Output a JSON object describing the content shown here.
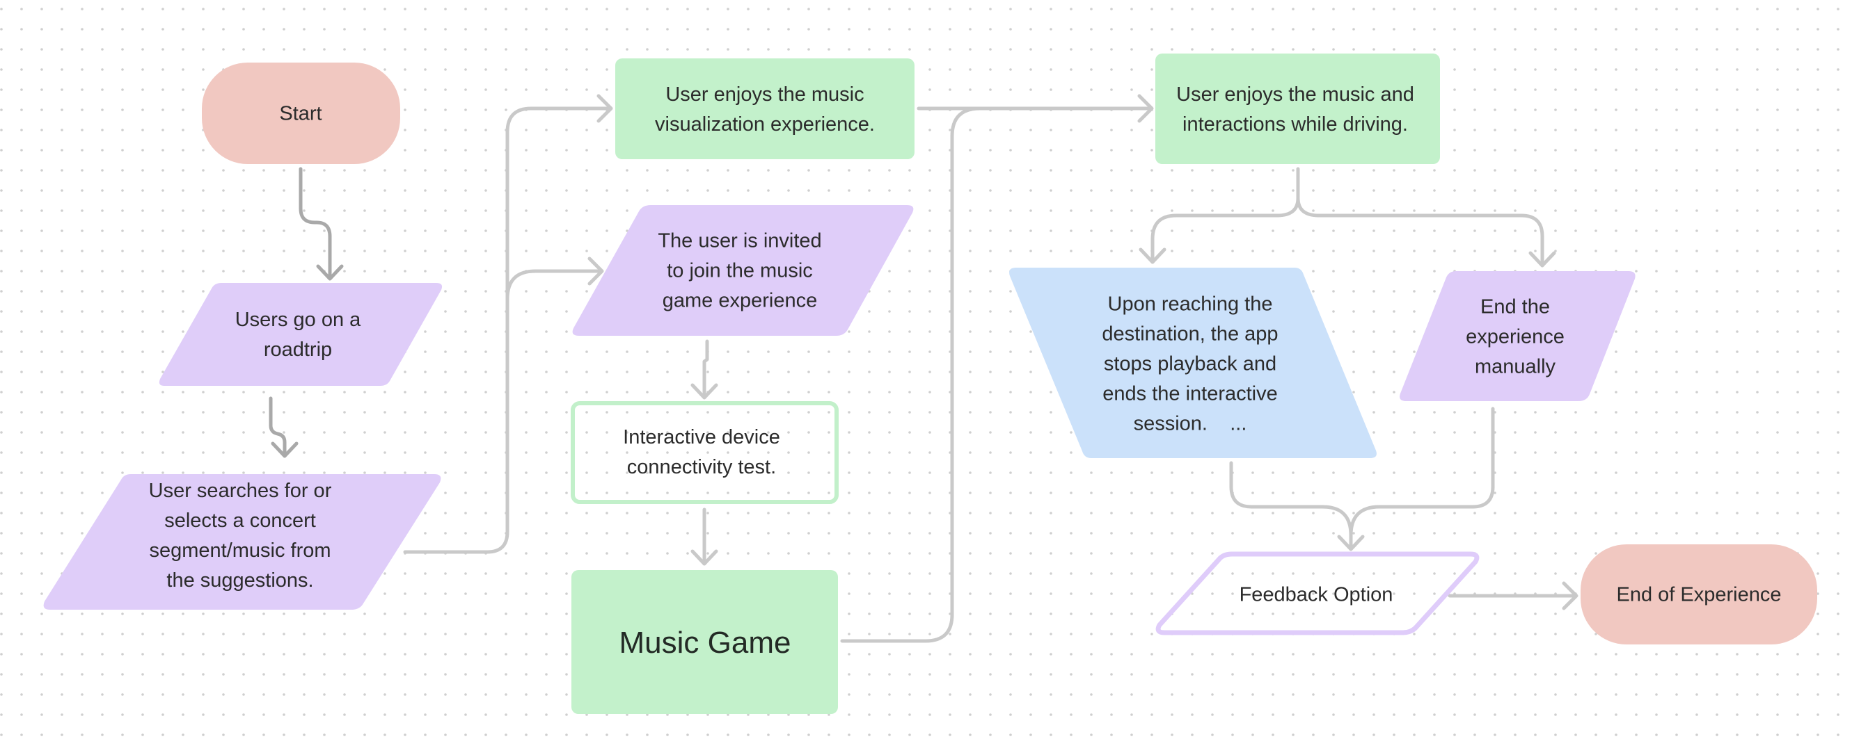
{
  "colors": {
    "terminator": "#f1c8c1",
    "io": "#dfcdf9",
    "process": "#c3f1cb",
    "decision_blue": "#cbe1fa",
    "connector": "#c9c9c9",
    "connector_dark": "#a9a9a9",
    "text": "#2b2b2b",
    "grid_dot": "#cfcfcf"
  },
  "nodes": {
    "start": {
      "type": "terminator",
      "lines": [
        "Start"
      ]
    },
    "roadtrip": {
      "type": "input-output",
      "lines": [
        "Users go on a",
        "roadtrip"
      ]
    },
    "search": {
      "type": "input-output",
      "lines": [
        "User searches for or",
        "selects a concert",
        "segment/music from",
        "the suggestions."
      ]
    },
    "visualization": {
      "type": "process",
      "lines": [
        "User enjoys the music",
        "visualization experience."
      ]
    },
    "invite": {
      "type": "input-output",
      "lines": [
        "The user is invited",
        "to join the music",
        "game experience"
      ]
    },
    "connectivity": {
      "type": "process-outline",
      "lines": [
        "Interactive device",
        "connectivity test."
      ]
    },
    "music_game": {
      "type": "process",
      "lines": [
        "Music Game"
      ]
    },
    "driving": {
      "type": "process",
      "lines": [
        "User enjoys the music and",
        "interactions while driving."
      ]
    },
    "destination": {
      "type": "input-output",
      "lines": [
        "Upon reaching the",
        "destination, the app",
        "stops playback and",
        "ends the interactive",
        "session.    ..."
      ]
    },
    "end_manual": {
      "type": "input-output",
      "lines": [
        "End the",
        "experience",
        "manually"
      ]
    },
    "feedback": {
      "type": "input-output-outline",
      "lines": [
        "Feedback Option"
      ]
    },
    "end": {
      "type": "terminator",
      "lines": [
        "End of Experience"
      ]
    }
  },
  "edges": [
    {
      "from": "start",
      "to": "roadtrip"
    },
    {
      "from": "roadtrip",
      "to": "search"
    },
    {
      "from": "search",
      "to": "visualization"
    },
    {
      "from": "search",
      "to": "invite"
    },
    {
      "from": "invite",
      "to": "connectivity"
    },
    {
      "from": "connectivity",
      "to": "music_game"
    },
    {
      "from": "visualization",
      "to": "driving"
    },
    {
      "from": "music_game",
      "to": "driving"
    },
    {
      "from": "driving",
      "to": "destination"
    },
    {
      "from": "driving",
      "to": "end_manual"
    },
    {
      "from": "destination",
      "to": "feedback"
    },
    {
      "from": "end_manual",
      "to": "feedback"
    },
    {
      "from": "feedback",
      "to": "end"
    }
  ]
}
